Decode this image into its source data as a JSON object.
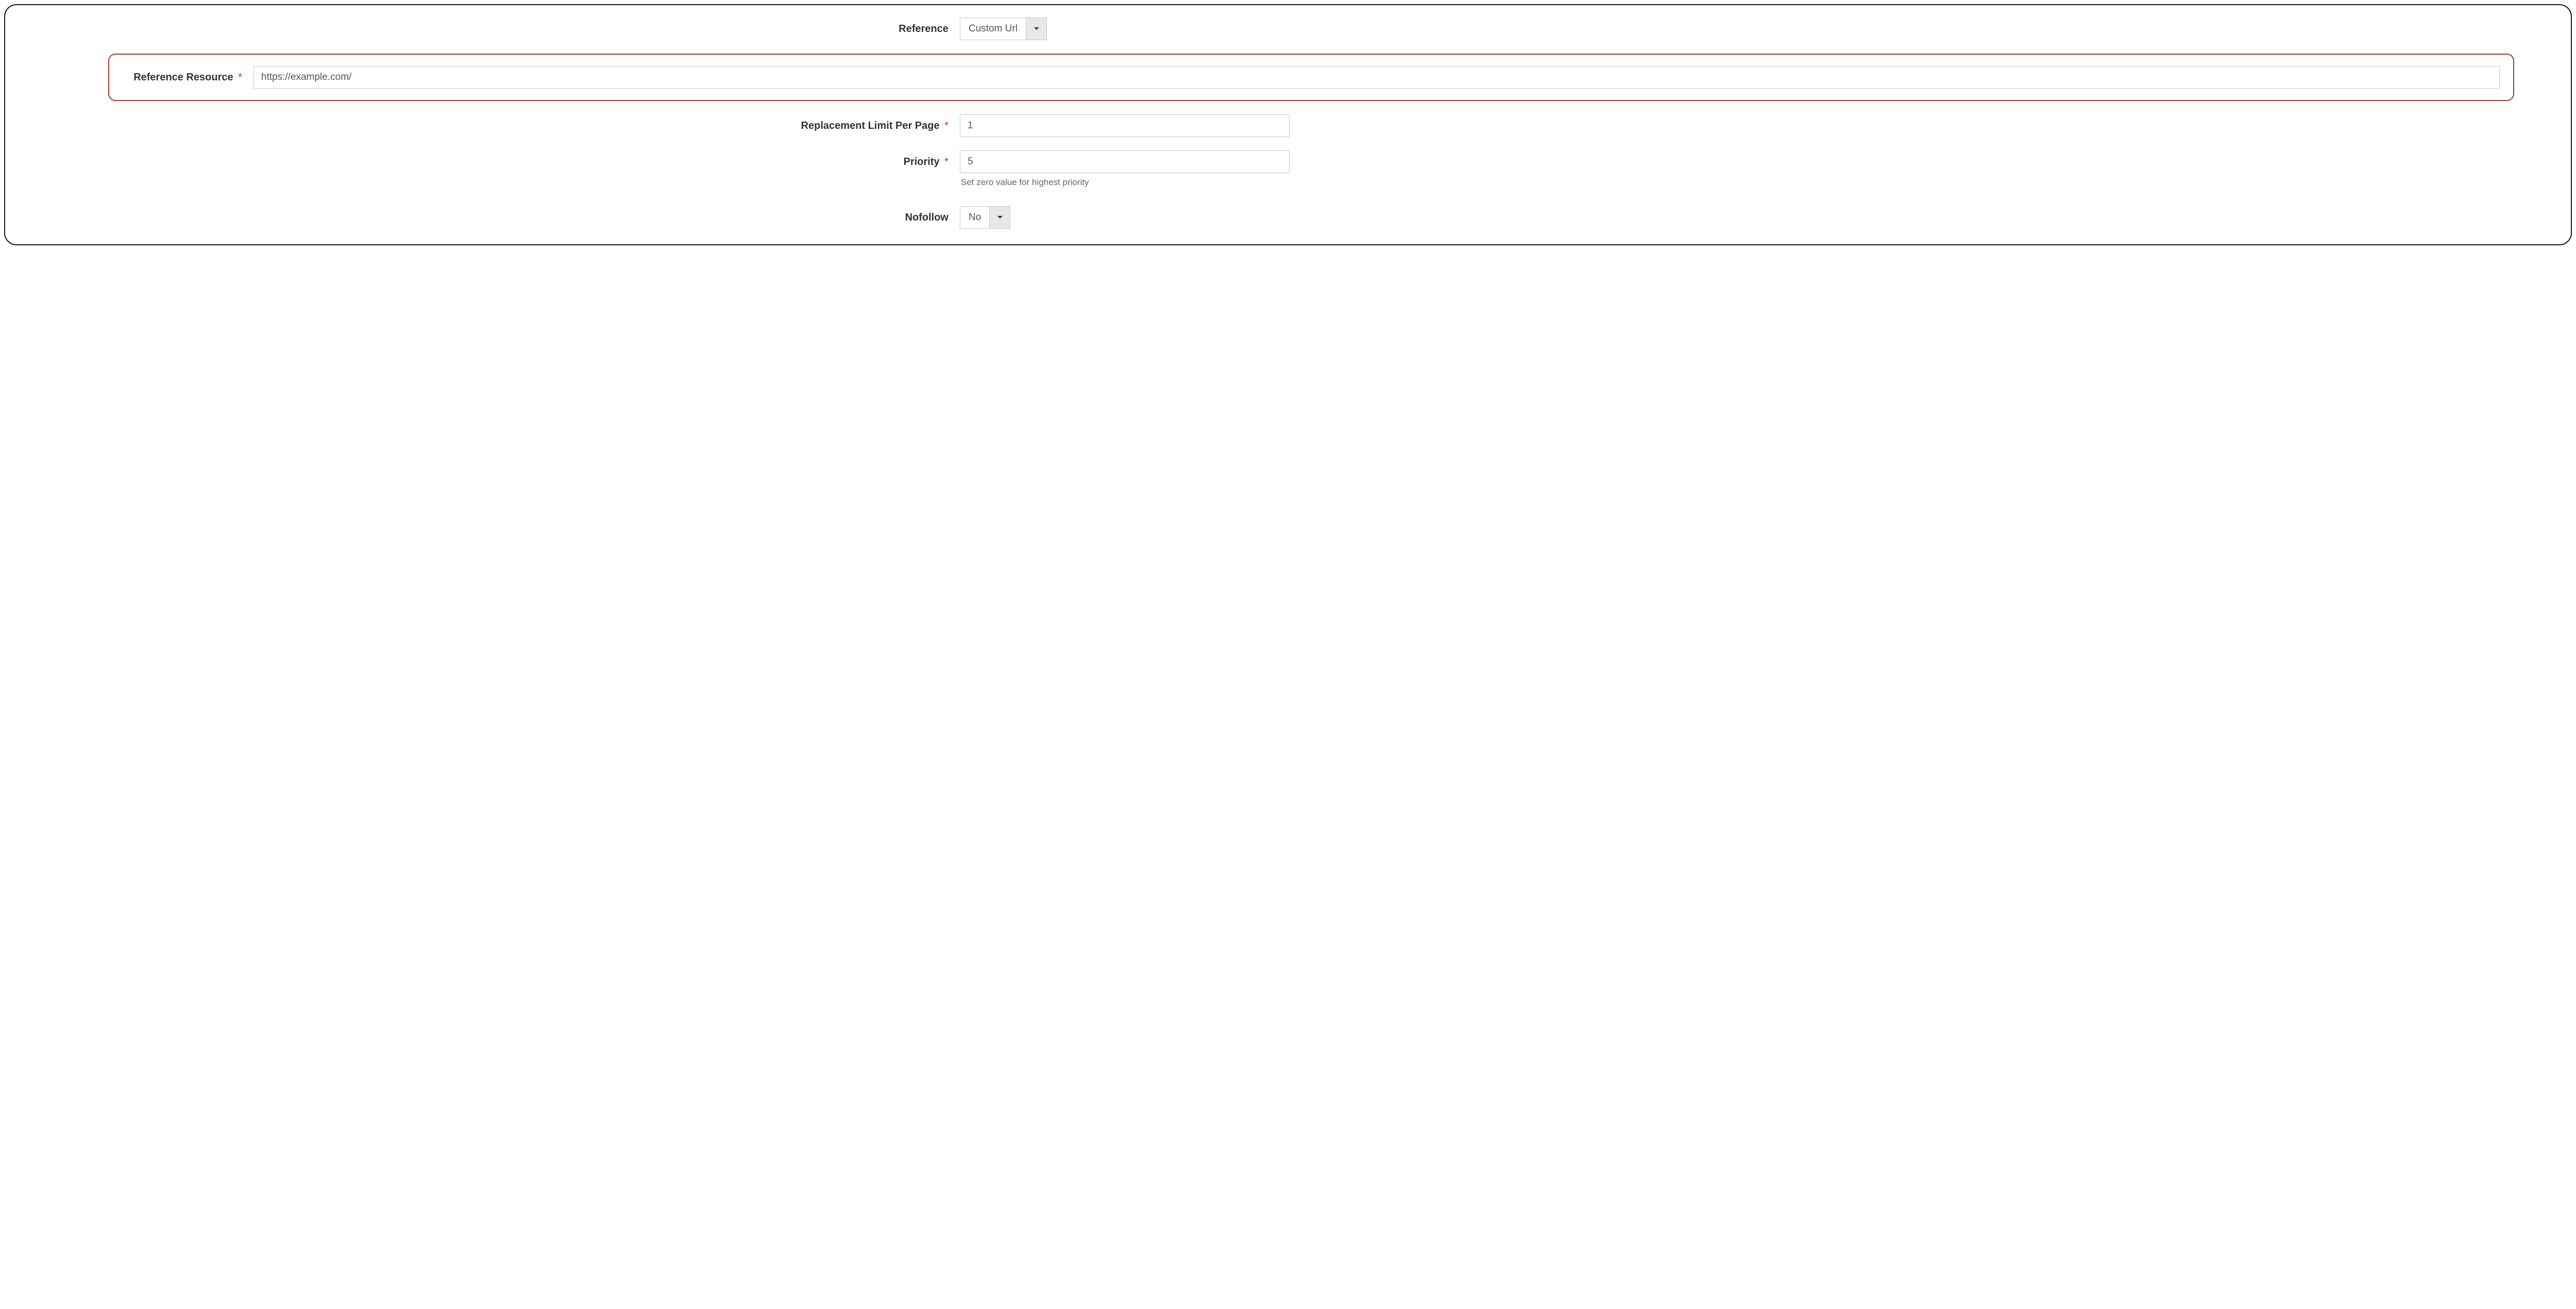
{
  "fields": {
    "reference": {
      "label": "Reference",
      "value": "Custom Url"
    },
    "reference_resource": {
      "label": "Reference Resource",
      "value": "https://example.com/"
    },
    "replacement_limit": {
      "label": "Replacement Limit Per Page",
      "value": "1"
    },
    "priority": {
      "label": "Priority",
      "value": "5",
      "help": "Set zero value for highest priority"
    },
    "nofollow": {
      "label": "Nofollow",
      "value": "No"
    }
  }
}
